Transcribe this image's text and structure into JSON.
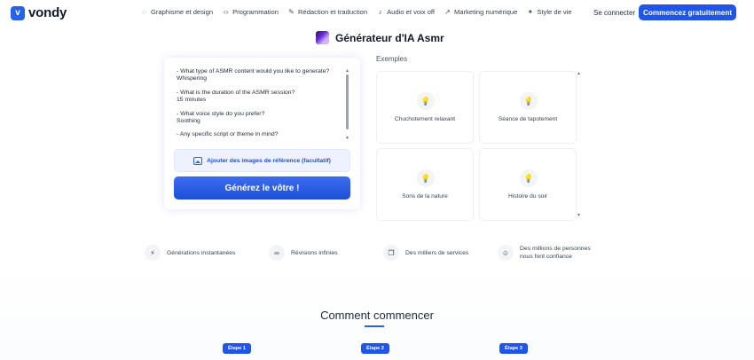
{
  "header": {
    "logo_mark": "v",
    "logo_text": "vondy",
    "nav": [
      {
        "icon": "palette-icon",
        "glyph": "◌",
        "label": "Graphisme et design"
      },
      {
        "icon": "code-icon",
        "glyph": "‹›",
        "label": "Programmation"
      },
      {
        "icon": "pen-icon",
        "glyph": "✎",
        "label": "Rédaction et traduction"
      },
      {
        "icon": "music-icon",
        "glyph": "♪",
        "label": "Audio et voix off"
      },
      {
        "icon": "trending-icon",
        "glyph": "↗",
        "label": "Marketing numérique"
      },
      {
        "icon": "sparkle-icon",
        "glyph": "✦",
        "label": "Style de vie"
      }
    ],
    "login_label": "Se connecter",
    "cta_label": "Commencez gratuitement"
  },
  "title": "Générateur d'IA Asmr",
  "form": {
    "questions": [
      {
        "q": "- What type of ASMR content would you like to generate?",
        "a": "Whispering"
      },
      {
        "q": "- What is the duration of the ASMR session?",
        "a": "15 minutes"
      },
      {
        "q": "- What voice style do you prefer?",
        "a": "Soothing"
      },
      {
        "q": "- Any specific script or theme in mind?",
        "a": ""
      }
    ],
    "reference_label": "Ajouter des images de référence (facultatif)",
    "generate_label": "Générez le vôtre !"
  },
  "examples": {
    "label": "Exemples",
    "items": [
      "Chuchotement relaxant",
      "Séance de tapotement",
      "Sons de la nature",
      "Histoire du soir"
    ]
  },
  "features": [
    {
      "icon": "lightning-icon",
      "glyph": "⚡",
      "label": "Générations instantanées"
    },
    {
      "icon": "infinity-icon",
      "glyph": "∞",
      "label": "Révisions infinies"
    },
    {
      "icon": "services-icon",
      "glyph": "❐",
      "label": "Des milliers de services"
    },
    {
      "icon": "users-icon",
      "glyph": "☺",
      "label": "Des millions de personnes nous font confiance"
    }
  ],
  "how": {
    "title": "Comment commencer",
    "steps": [
      "Étape 1",
      "Étape 2",
      "Étape 3"
    ]
  },
  "colors": {
    "accent": "#2056e8",
    "text": "#1f2937"
  }
}
